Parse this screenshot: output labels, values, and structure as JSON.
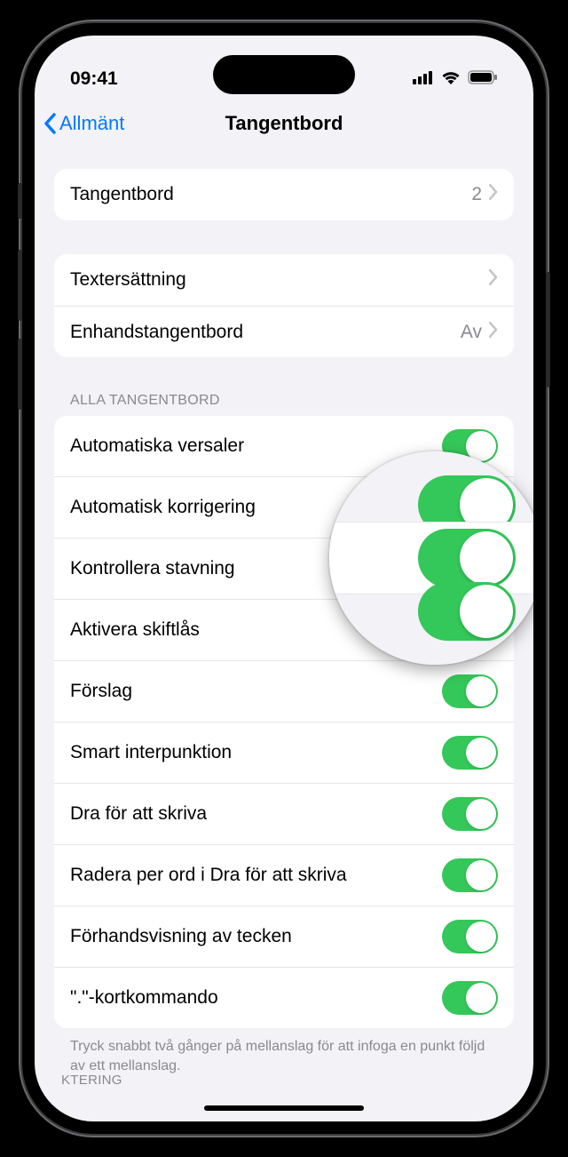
{
  "status": {
    "time": "09:41"
  },
  "nav": {
    "back": "Allmänt",
    "title": "Tangentbord"
  },
  "groups": [
    {
      "rows": [
        {
          "label": "Tangentbord",
          "value": "2",
          "type": "nav"
        }
      ]
    },
    {
      "rows": [
        {
          "label": "Textersättning",
          "type": "nav"
        },
        {
          "label": "Enhandstangentbord",
          "value": "Av",
          "type": "nav"
        }
      ]
    }
  ],
  "section_header": "ALLA TANGENTBORD",
  "toggles": [
    {
      "label": "Automatiska versaler",
      "on": true
    },
    {
      "label": "Automatisk korrigering",
      "on": true
    },
    {
      "label": "Kontrollera stavning",
      "on": true
    },
    {
      "label": "Aktivera skiftlås",
      "on": true
    },
    {
      "label": "Förslag",
      "on": true
    },
    {
      "label": "Smart interpunktion",
      "on": true
    },
    {
      "label": "Dra för att skriva",
      "on": true
    },
    {
      "label": "Radera per ord i Dra för att skriva",
      "on": true
    },
    {
      "label": "Förhandsvisning av tecken",
      "on": true
    },
    {
      "label": "\".\"-kortkommando",
      "on": true
    }
  ],
  "footer": "Tryck snabbt två gånger på mellanslag för att infoga en punkt följd av ett mellanslag.",
  "cutoff": "KTERING"
}
